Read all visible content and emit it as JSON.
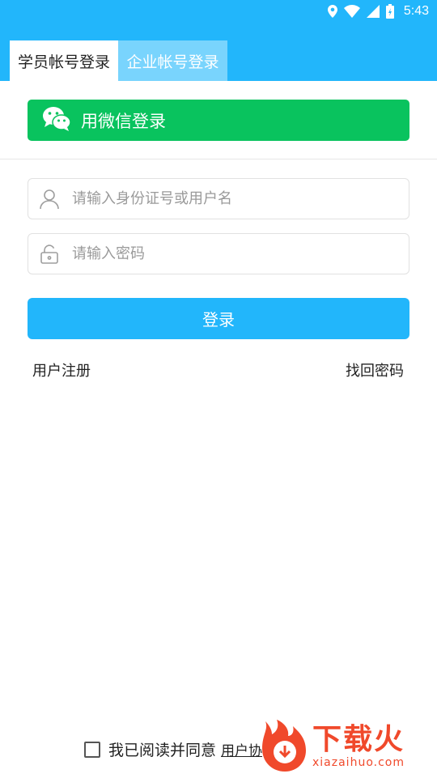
{
  "status_bar": {
    "time": "5:43",
    "icons": [
      "location-icon",
      "wifi-icon",
      "signal-icon",
      "battery-icon"
    ]
  },
  "tabs": [
    {
      "label": "学员帐号登录",
      "active": true
    },
    {
      "label": "企业帐号登录",
      "active": false
    }
  ],
  "wechat_login": {
    "label": "用微信登录",
    "icon": "wechat-icon",
    "color": "#09c35e"
  },
  "account_field": {
    "placeholder": "请输入身份证号或用户名",
    "value": "",
    "icon": "user-icon"
  },
  "password_field": {
    "placeholder": "请输入密码",
    "value": "",
    "icon": "lock-icon"
  },
  "login_button": {
    "label": "登录",
    "color": "#22b6fb"
  },
  "links": {
    "register": "用户注册",
    "forgot": "找回密码"
  },
  "agreement": {
    "text": "我已阅读并同意",
    "link": "用户协",
    "checked": false
  },
  "watermark": {
    "title": "下载火",
    "url": "xiazaihuo.com"
  },
  "colors": {
    "primary": "#22b6fb",
    "tab_inactive": "#79d4fd",
    "watermark": "#f0492b"
  }
}
